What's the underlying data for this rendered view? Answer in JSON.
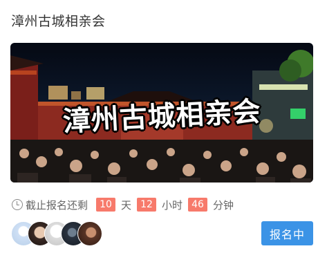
{
  "event": {
    "title": "漳州古城相亲会",
    "banner_text": "漳州古城相亲会"
  },
  "countdown": {
    "lead_text": "截止报名还剩",
    "days": "10",
    "days_unit": "天",
    "hours": "12",
    "hours_unit": "小时",
    "minutes": "46",
    "minutes_unit": "分钟"
  },
  "participants": {
    "avatar_count_shown": 5
  },
  "actions": {
    "signup_label": "报名中"
  },
  "colors": {
    "accent_blue": "#3b93e6",
    "countdown_badge": "#f77a6b"
  }
}
